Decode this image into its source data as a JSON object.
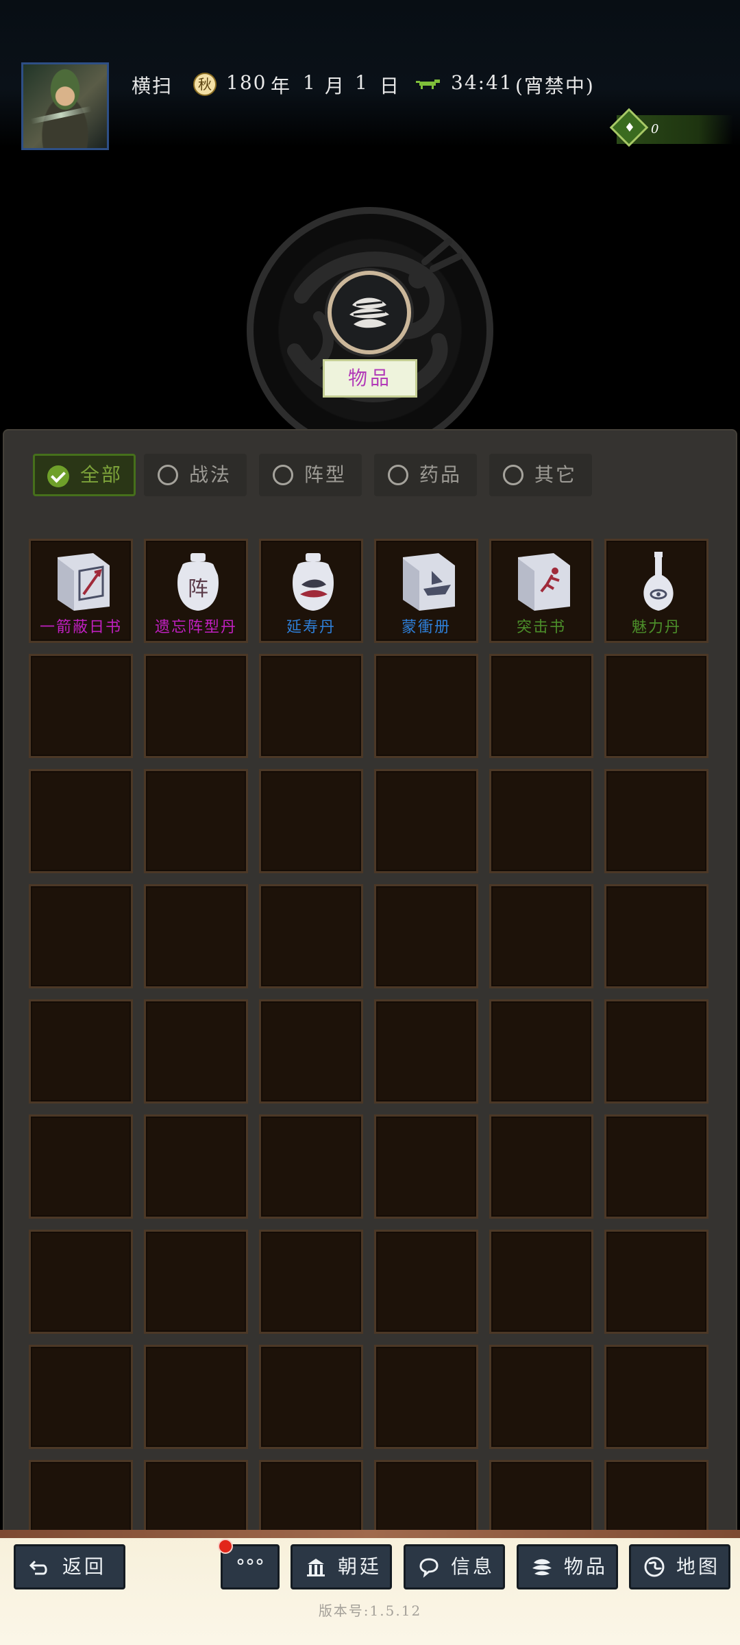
{
  "header": {
    "name": "横扫",
    "year": "180",
    "year_unit": "年",
    "month": "1",
    "month_unit": "月",
    "day": "1",
    "day_unit": "日",
    "time": "34:41",
    "status": "(宵禁中)",
    "money": "0"
  },
  "page": {
    "title": "物品"
  },
  "tabs": [
    {
      "label": "全部",
      "active": true
    },
    {
      "label": "战法",
      "active": false
    },
    {
      "label": "阵型",
      "active": false
    },
    {
      "label": "药品",
      "active": false
    },
    {
      "label": "其它",
      "active": false
    }
  ],
  "items": [
    {
      "name": "一箭蔽日书",
      "icon": "book-arrow-icon",
      "color": "#c020c0"
    },
    {
      "name": "遗忘阵型丹",
      "icon": "jar-formation-icon",
      "color": "#c020c0"
    },
    {
      "name": "延寿丹",
      "icon": "jar-longevity-icon",
      "color": "#2e7fd8"
    },
    {
      "name": "蒙衝册",
      "icon": "book-ship-icon",
      "color": "#2e7fd8"
    },
    {
      "name": "突击书",
      "icon": "book-runner-icon",
      "color": "#4c8f2a"
    },
    {
      "name": "魅力丹",
      "icon": "vase-eye-icon",
      "color": "#4c8f2a"
    }
  ],
  "grid": {
    "rows_visible": 9,
    "cols": 6
  },
  "nav": {
    "back": "返回",
    "more": "°°°",
    "court": "朝廷",
    "info": "信息",
    "items": "物品",
    "map": "地图"
  },
  "version": "版本号:1.5.12"
}
